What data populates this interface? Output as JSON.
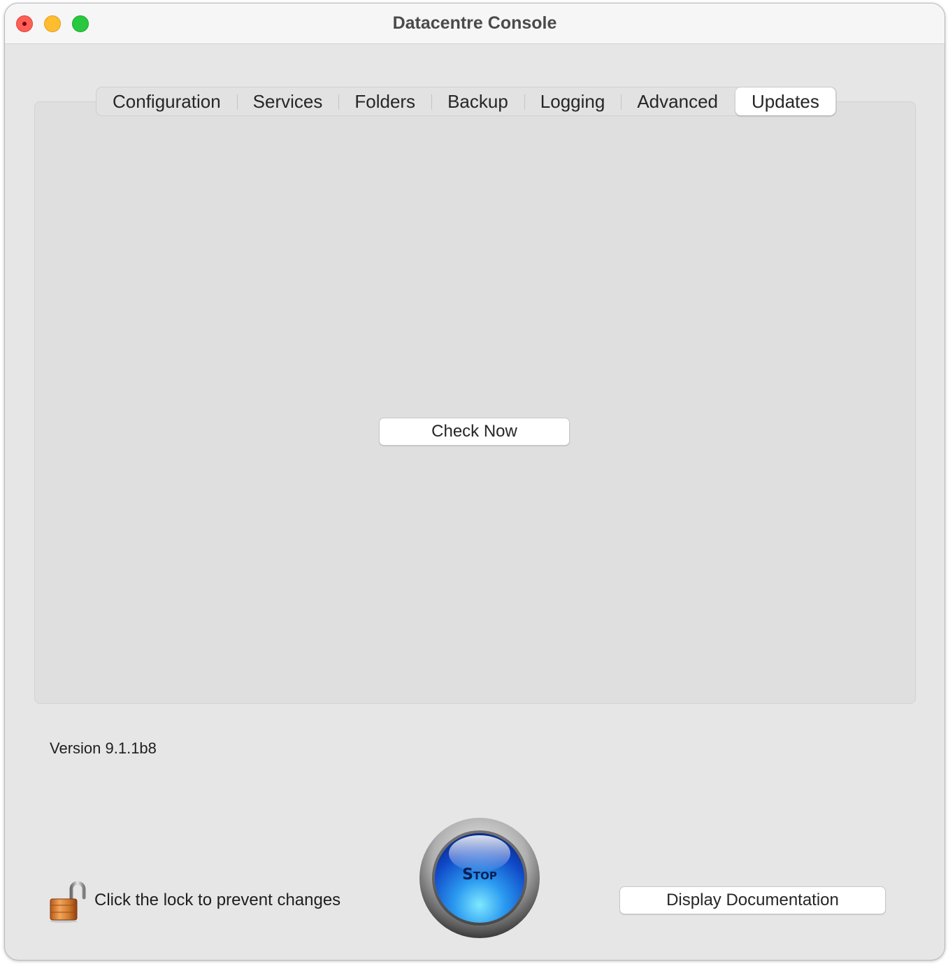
{
  "window": {
    "title": "Datacentre Console"
  },
  "tabs": [
    {
      "label": "Configuration",
      "selected": false
    },
    {
      "label": "Services",
      "selected": false
    },
    {
      "label": "Folders",
      "selected": false
    },
    {
      "label": "Backup",
      "selected": false
    },
    {
      "label": "Logging",
      "selected": false
    },
    {
      "label": "Advanced",
      "selected": false
    },
    {
      "label": "Updates",
      "selected": true
    }
  ],
  "updates_panel": {
    "check_now_label": "Check Now"
  },
  "footer": {
    "version": "Version 9.1.1b8",
    "lock_label": "Click the lock to prevent changes",
    "lock_icon": "unlocked-padlock-icon",
    "stop_label": "Stop",
    "doc_button_label": "Display Documentation"
  },
  "colors": {
    "close": "#fe5f57",
    "minimize": "#febc2e",
    "maximize": "#28c840",
    "stop_blue": "#1f6fe0"
  }
}
